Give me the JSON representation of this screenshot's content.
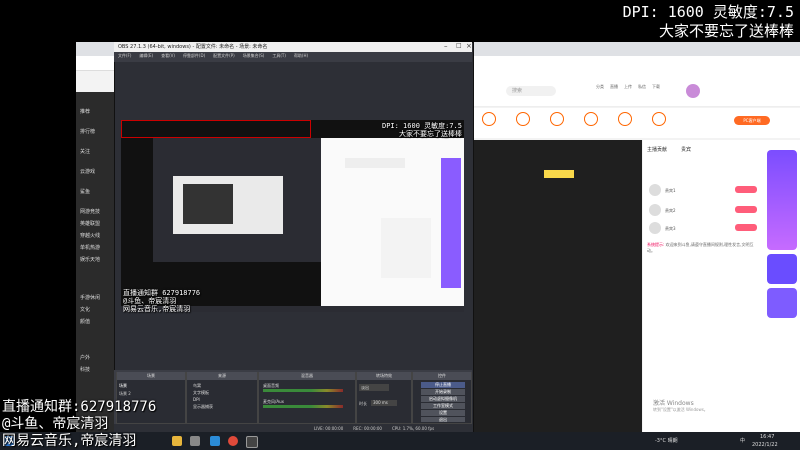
{
  "overlay": {
    "dpi_line": "DPI: 1600 灵敏度:7.5",
    "reminder": "大家不要忘了送棒棒",
    "group_line": "直播通知群:627918776",
    "douyu_line": "@斗鱼、帝宸清羽",
    "music_line": "网易云音乐,帝宸清羽"
  },
  "obs": {
    "title": "OBS 27.1.3 (64-bit, windows) - 配置文件: 未命名 - 场景: 未命名",
    "menu": [
      "文件(F)",
      "编辑(E)",
      "查看(V)",
      "停靠部件(D)",
      "配置文件(P)",
      "场景集合(S)",
      "工具(T)",
      "帮助(H)"
    ],
    "preview_overlay": {
      "dpi_line": "DPI: 1600 灵敏度:7.5",
      "reminder": "大家不要忘了送棒棒",
      "group_line": "直播通知群 627918776",
      "douyu_line": "@斗鱼、帝宸清羽",
      "music_line": "网易云音乐,帝宸清羽"
    },
    "docks": {
      "scenes": {
        "title": "场景",
        "items": [
          "场景",
          "场景 2"
        ]
      },
      "sources": {
        "title": "来源",
        "items": [
          "鸟窝",
          "文字模板",
          "DPI",
          "显示器捕获"
        ]
      },
      "mixer": {
        "title": "混音器",
        "items": [
          "桌面音频",
          "麦克风/Aux"
        ]
      },
      "transitions": {
        "title": "转场特效",
        "type": "淡出",
        "duration_label": "时长",
        "duration": "300 ms"
      },
      "controls": {
        "title": "控件",
        "buttons": [
          "停止直播",
          "开始录制",
          "启动虚拟摄像机",
          "工作室模式",
          "设置",
          "退出"
        ]
      }
    },
    "status": [
      "LIVE: 00:00:00",
      "REC: 00:00:00",
      "CPU: 1.7%, 60.00 fps"
    ]
  },
  "browser": {
    "search_placeholder": "搜索",
    "nav_items": [
      "分类",
      "直播",
      "上传",
      "私信",
      "下载"
    ],
    "sidebar_items": [
      "推荐",
      "排行榜",
      "关注",
      "云游戏",
      "鲨鱼",
      "网游竞技",
      "英雄联盟",
      "穿越火线",
      "单机热游",
      "娱乐天地",
      "手游休闲",
      "文化",
      "颜值",
      "户外",
      "科技"
    ],
    "pc_client_btn": "PC客户端",
    "chat_tabs": [
      "主播贡献",
      "贵宾"
    ],
    "notice_label": "系统提示:",
    "activate_line1": "激活 Windows",
    "activate_line2": "转到\"设置\"以激活 Windows。",
    "chat_rank": [
      "贵宾1",
      "贵宾2",
      "贵宾3"
    ],
    "chat_text": "欢迎来到斗鱼,请遵守直播间规则,理性发言,文明互动。"
  },
  "taskbar": {
    "weather": "-3°C 晴朗",
    "time": "16:47",
    "date": "2022/1/22",
    "lang": "中"
  }
}
